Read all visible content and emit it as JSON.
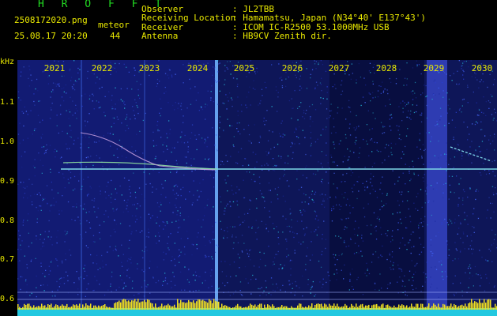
{
  "header": {
    "app_name": "H R O F F T",
    "filename": "2508172020.png",
    "timestamp": "25.08.17 20:20",
    "meteor_label": "meteor",
    "meteor_count": "44",
    "fields": [
      {
        "label": "Observer",
        "value": ": JL2TBB"
      },
      {
        "label": "Receiving Location",
        "value": ": Hamamatsu, Japan (N34°40' E137°43')"
      },
      {
        "label": "Receiver",
        "value": ": ICOM IC-R2500 53.1000MHz USB"
      },
      {
        "label": "Antenna",
        "value": ": HB9CV Zenith dir."
      }
    ]
  },
  "axis": {
    "y_unit": "kHz",
    "y_ticks": [
      "1.1",
      "1.0",
      "0.9",
      "0.8",
      "0.7",
      "0.6"
    ],
    "x_ticks": [
      "2021",
      "2022",
      "2023",
      "2024",
      "2025",
      "2026",
      "2027",
      "2028",
      "2029",
      "2030"
    ]
  },
  "colors": {
    "text": "#e8e800",
    "title": "#22dd22",
    "background": "#000000",
    "noise_base": "#101a60",
    "carrier": "#7fd8e8"
  }
}
